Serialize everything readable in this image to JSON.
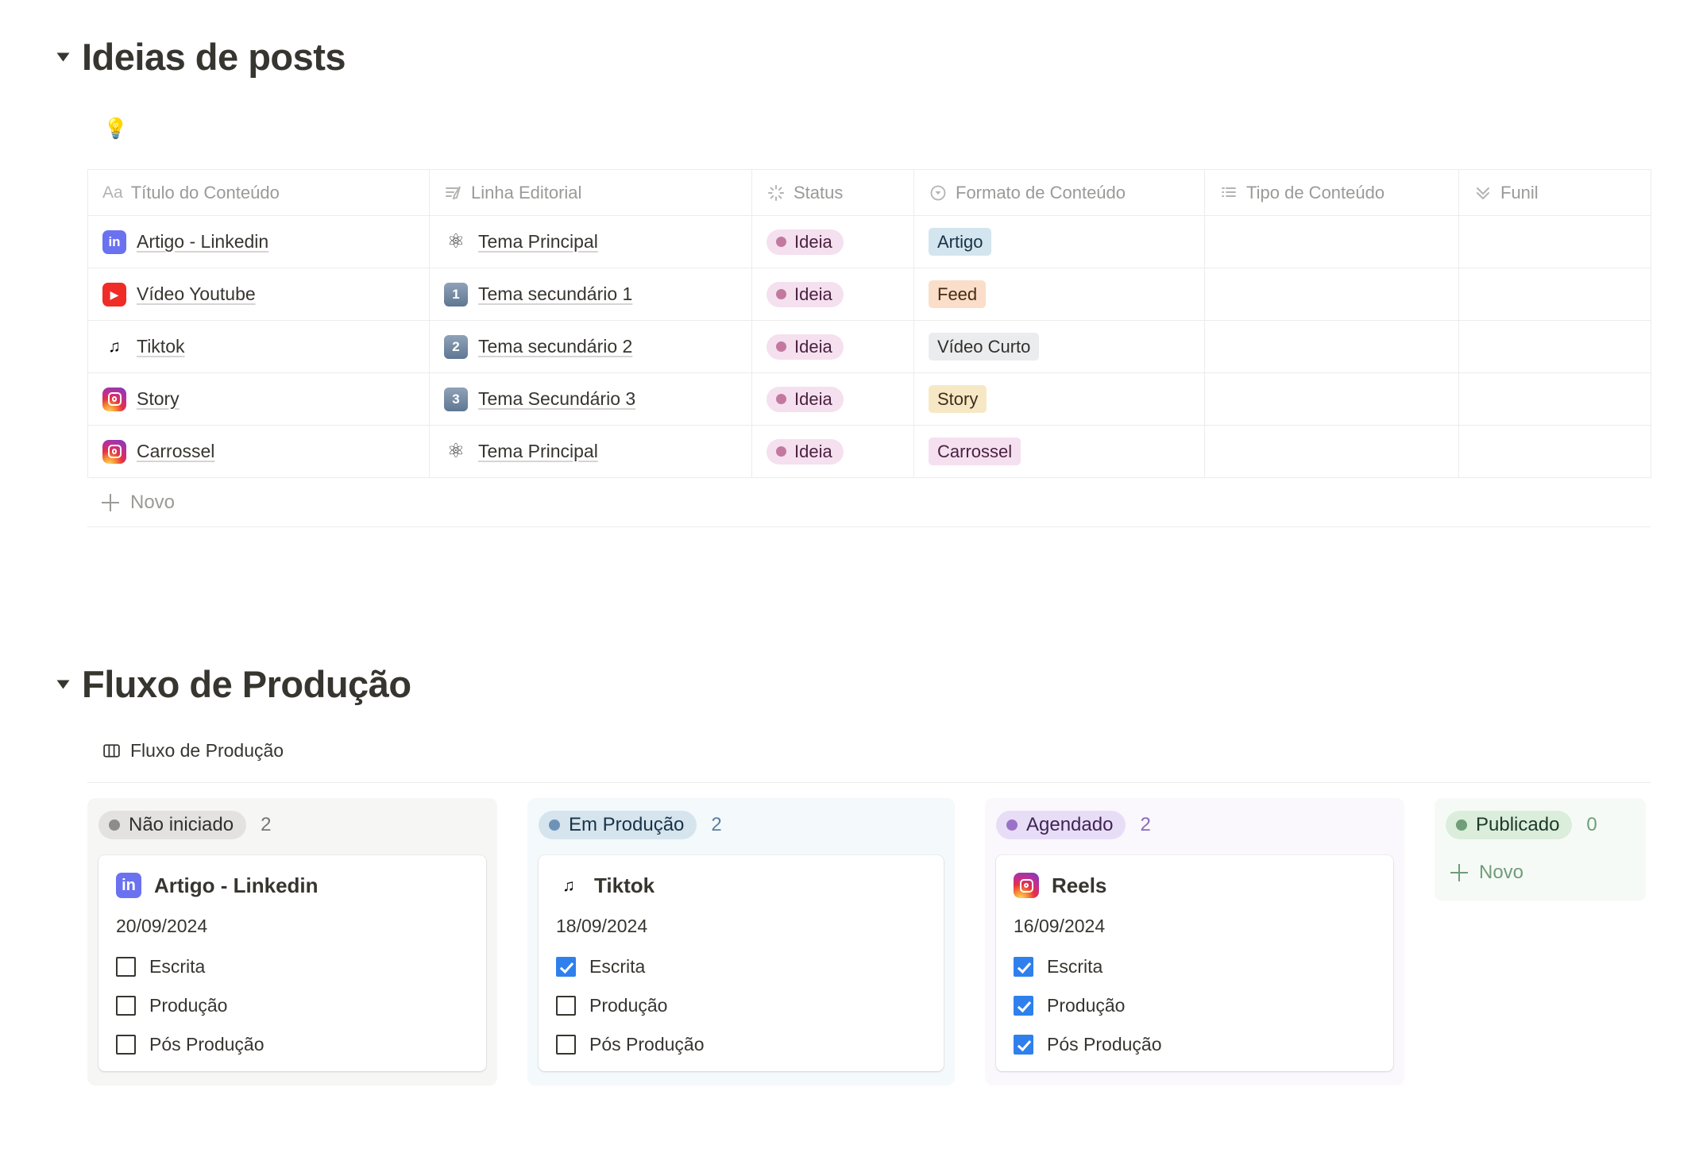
{
  "sections": [
    {
      "title": "Ideias de posts"
    },
    {
      "title": "Fluxo de Produção"
    }
  ],
  "ideas_db": {
    "emoji": "💡",
    "columns": [
      {
        "label": "Título do Conteúdo",
        "icon": "text-aa-icon"
      },
      {
        "label": "Linha Editorial",
        "icon": "rich-text-icon"
      },
      {
        "label": "Status",
        "icon": "status-spinner-icon"
      },
      {
        "label": "Formato de Conteúdo",
        "icon": "select-circle-icon"
      },
      {
        "label": "Tipo de Conteúdo",
        "icon": "multi-select-list-icon"
      },
      {
        "label": "Funil",
        "icon": "chevrons-down-icon"
      }
    ],
    "rows": [
      {
        "icon": "linkedin-icon",
        "icon_glyph": "in",
        "title": "Artigo - Linkedin",
        "editorial_icon": "atom-icon",
        "editorial_glyph": "⚛",
        "editorial": "Tema Principal",
        "status": "Ideia",
        "format": "Artigo",
        "format_style": "tag-artigo",
        "type": "",
        "funnel": ""
      },
      {
        "icon": "youtube-icon",
        "icon_glyph": "▶",
        "title": "Vídeo Youtube",
        "editorial_icon": "number-one-icon",
        "editorial_glyph": "1",
        "editorial": "Tema secundário 1",
        "status": "Ideia",
        "format": "Feed",
        "format_style": "tag-feed",
        "type": "",
        "funnel": ""
      },
      {
        "icon": "tiktok-icon",
        "icon_glyph": "♪",
        "title": "Tiktok",
        "editorial_icon": "number-two-icon",
        "editorial_glyph": "2",
        "editorial": "Tema secundário 2",
        "status": "Ideia",
        "format": "Vídeo Curto",
        "format_style": "tag-video",
        "type": "",
        "funnel": ""
      },
      {
        "icon": "instagram-icon",
        "icon_glyph": "◎",
        "title": "Story",
        "editorial_icon": "number-three-icon",
        "editorial_glyph": "3",
        "editorial": "Tema Secundário 3",
        "status": "Ideia",
        "format": "Story",
        "format_style": "tag-story",
        "type": "",
        "funnel": ""
      },
      {
        "icon": "instagram-icon",
        "icon_glyph": "◎",
        "title": "Carrossel",
        "editorial_icon": "atom-icon",
        "editorial_glyph": "⚛",
        "editorial": "Tema Principal",
        "status": "Ideia",
        "format": "Carrossel",
        "format_style": "tag-carrossel",
        "type": "",
        "funnel": ""
      }
    ],
    "new_row_label": "Novo"
  },
  "flow_db": {
    "view_icon": "board-view-icon",
    "view_label": "Fluxo de Produção",
    "checklist_labels": [
      "Escrita",
      "Produção",
      "Pós Produção"
    ],
    "new_label": "Novo",
    "columns": [
      {
        "name": "Não iniciado",
        "count": "2",
        "dot_color": "#8c8c8c",
        "pill_bg": "#e3e2e0",
        "pill_text": "#32302c",
        "col_bg": "#f6f6f5",
        "count_color": "#787774",
        "cards": [
          {
            "icon": "linkedin-icon",
            "icon_glyph": "in",
            "title": "Artigo - Linkedin",
            "date": "20/09/2024",
            "checks": [
              false,
              false,
              false
            ]
          }
        ]
      },
      {
        "name": "Em Produção",
        "count": "2",
        "dot_color": "#6f93b8",
        "pill_bg": "#d6e4ee",
        "pill_text": "#183347",
        "col_bg": "#f4f9fc",
        "count_color": "#5b7f9e",
        "cards": [
          {
            "icon": "tiktok-icon",
            "icon_glyph": "♪",
            "title": "Tiktok",
            "date": "18/09/2024",
            "checks": [
              true,
              false,
              false
            ]
          }
        ]
      },
      {
        "name": "Agendado",
        "count": "2",
        "dot_color": "#9a73c8",
        "pill_bg": "#e8ddf7",
        "pill_text": "#412454",
        "col_bg": "#faf7fd",
        "count_color": "#8d6bb5",
        "cards": [
          {
            "icon": "instagram-icon",
            "icon_glyph": "◎",
            "title": "Reels",
            "date": "16/09/2024",
            "checks": [
              true,
              true,
              true
            ]
          }
        ]
      },
      {
        "name": "Publicado",
        "count": "0",
        "dot_color": "#6f9e78",
        "pill_bg": "#dbeddb",
        "pill_text": "#1c3829",
        "col_bg": "#f6faf6",
        "count_color": "#6f9e78",
        "cards": []
      }
    ]
  }
}
